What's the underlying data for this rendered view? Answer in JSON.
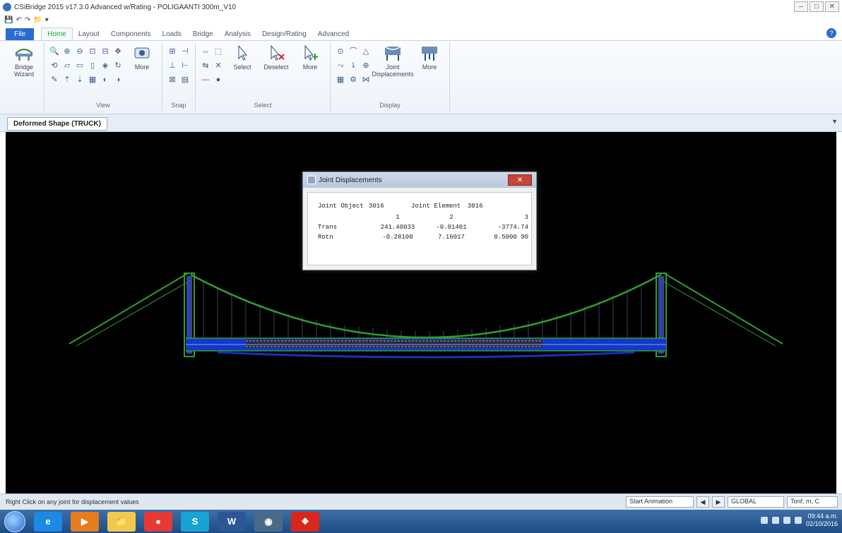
{
  "window": {
    "title": "CSiBridge 2015 v17.3.0 Advanced w/Rating  - POLIGAANTI 300m_V10",
    "controls": [
      "–",
      "□",
      "✕"
    ]
  },
  "quick_access": [
    "💾",
    "↶",
    "↷",
    "📁",
    "▾"
  ],
  "ribbon_tabs": [
    "File",
    "Home",
    "Layout",
    "Components",
    "Loads",
    "Bridge",
    "Analysis",
    "Design/Rating",
    "Advanced"
  ],
  "active_tab": "Home",
  "ribbon": {
    "groups": [
      {
        "label": "",
        "buttons": [
          "Bridge Wizard"
        ]
      },
      {
        "label": "View",
        "buttons": [
          "More"
        ]
      },
      {
        "label": "Snap",
        "buttons": []
      },
      {
        "label": "Select",
        "buttons": [
          "Select",
          "Deselect",
          "More"
        ]
      },
      {
        "label": "Display",
        "buttons": [
          "Joint Displacements",
          "More"
        ]
      }
    ]
  },
  "document_tab": "Deformed Shape (TRUCK)",
  "dialog": {
    "title": "Joint Displacements",
    "joint_object_label": "Joint Object",
    "joint_object_value": "3016",
    "joint_element_label": "Joint Element",
    "joint_element_value": "3016",
    "column_headers": [
      "1",
      "2",
      "3"
    ],
    "rows": [
      {
        "label": "Trans",
        "values": [
          "241.40033",
          "-0.01401",
          "-3774.74"
        ]
      },
      {
        "label": "Rotn",
        "values": [
          "-0.28100",
          "7.16017",
          "0.5000 90"
        ]
      }
    ],
    "close_label": "✕"
  },
  "statusbar": {
    "message": "Right Click on any joint for displacement values",
    "start_animation": "Start Animation",
    "prev": "◀",
    "next": "▶",
    "coord_system": "GLOBAL",
    "units": "Tonf, m, C"
  },
  "taskbar": {
    "apps": [
      "e",
      "▶",
      "📁",
      "●",
      "S",
      "W",
      "◉",
      "❖"
    ],
    "app_colors": [
      "#1e88e5",
      "#e57c1e",
      "#f2c94c",
      "#e53935",
      "#19a3d4",
      "#2b5797",
      "#4a6a8a",
      "#d9281a"
    ],
    "time": "09:44 a.m.",
    "date": "02/10/2016"
  },
  "colors": {
    "accent": "#2b6bd1",
    "cable": "#2f9e2f",
    "deck": "#1538c9",
    "tower": "#3d55c8"
  }
}
